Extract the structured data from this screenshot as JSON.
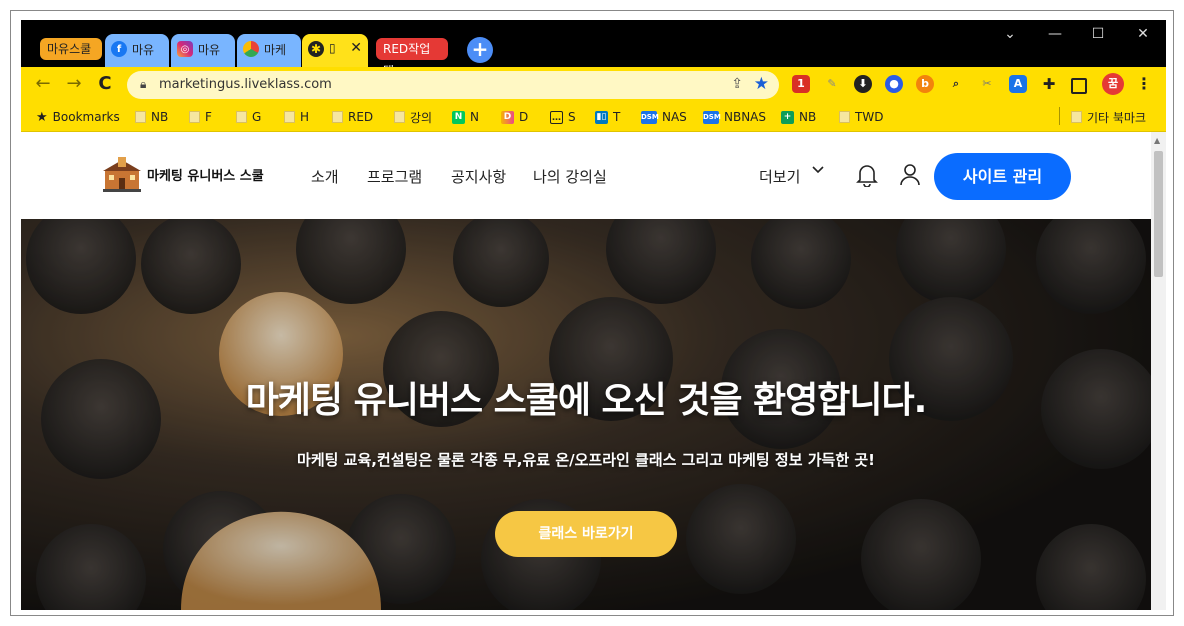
{
  "browser": {
    "tab_groups": [
      {
        "label": "마유스쿨",
        "color": "#f5a623"
      },
      {
        "label": "RED작업탭",
        "color": "#e53935"
      }
    ],
    "tabs": [
      {
        "label": "마유",
        "icon": "facebook-icon"
      },
      {
        "label": "마유",
        "icon": "instagram-icon"
      },
      {
        "label": "마케",
        "icon": "chrome-web-store-icon"
      },
      {
        "label": "",
        "icon": "site-favicon",
        "active": true
      }
    ],
    "new_tab_symbol": "+",
    "window_controls": {
      "minimize": "—",
      "maximize": "☐",
      "close": "✕",
      "tab_search": "⌄"
    },
    "address": {
      "url": "marketingus.liveklass.com"
    },
    "toolbar_color": "#ffde00"
  },
  "bookmarks": {
    "items": [
      {
        "label": "Bookmarks",
        "icon": "star-icon"
      },
      {
        "label": "NB",
        "icon": "folder-icon"
      },
      {
        "label": "F",
        "icon": "folder-icon"
      },
      {
        "label": "G",
        "icon": "folder-icon"
      },
      {
        "label": "H",
        "icon": "folder-icon"
      },
      {
        "label": "RED",
        "icon": "folder-icon"
      },
      {
        "label": "강의",
        "icon": "folder-icon"
      },
      {
        "label": "N",
        "icon": "naver-icon"
      },
      {
        "label": "D",
        "icon": "d-icon"
      },
      {
        "label": "S",
        "icon": "chat-icon"
      },
      {
        "label": "T",
        "icon": "trello-icon"
      },
      {
        "label": "NAS",
        "icon": "dsm-icon"
      },
      {
        "label": "NBNAS",
        "icon": "dsm-icon"
      },
      {
        "label": "NB",
        "icon": "plus-green-icon"
      },
      {
        "label": "TWD",
        "icon": "folder-icon"
      }
    ],
    "other": "기타 북마크"
  },
  "site": {
    "logo_text": "마케팅 유니버스 스쿨",
    "nav": [
      "소개",
      "프로그램",
      "공지사항",
      "나의 강의실"
    ],
    "more": "더보기",
    "manage_button": "사이트 관리",
    "accent": "#0a6cff"
  },
  "hero": {
    "title": "마케팅 유니버스 스쿨에 오신 것을 환영합니다.",
    "subtitle": "마케팅 교육,컨설팅은 물론 각종 무,유료 온/오프라인 클래스 그리고 마케팅 정보 가득한 곳!",
    "button": "클래스 바로가기",
    "button_color": "#f6c744"
  }
}
